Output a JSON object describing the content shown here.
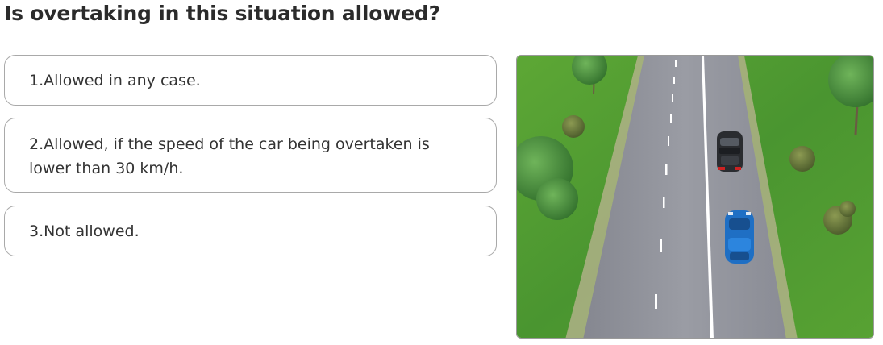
{
  "question": "Is overtaking in this situation allowed?",
  "answers": [
    {
      "label": "1.Allowed in any case."
    },
    {
      "label": "2.Allowed, if the speed of the car being overtaken is lower than 30 km/h."
    },
    {
      "label": "3.Not allowed."
    }
  ],
  "illustration": {
    "icons": [
      "road-scene",
      "dark-car",
      "blue-car",
      "tree",
      "bush"
    ],
    "colors": {
      "grass": "#4f9a2f",
      "road": "#8e9099",
      "car_dark": "#2a2c30",
      "car_blue": "#1f6fc4"
    }
  }
}
